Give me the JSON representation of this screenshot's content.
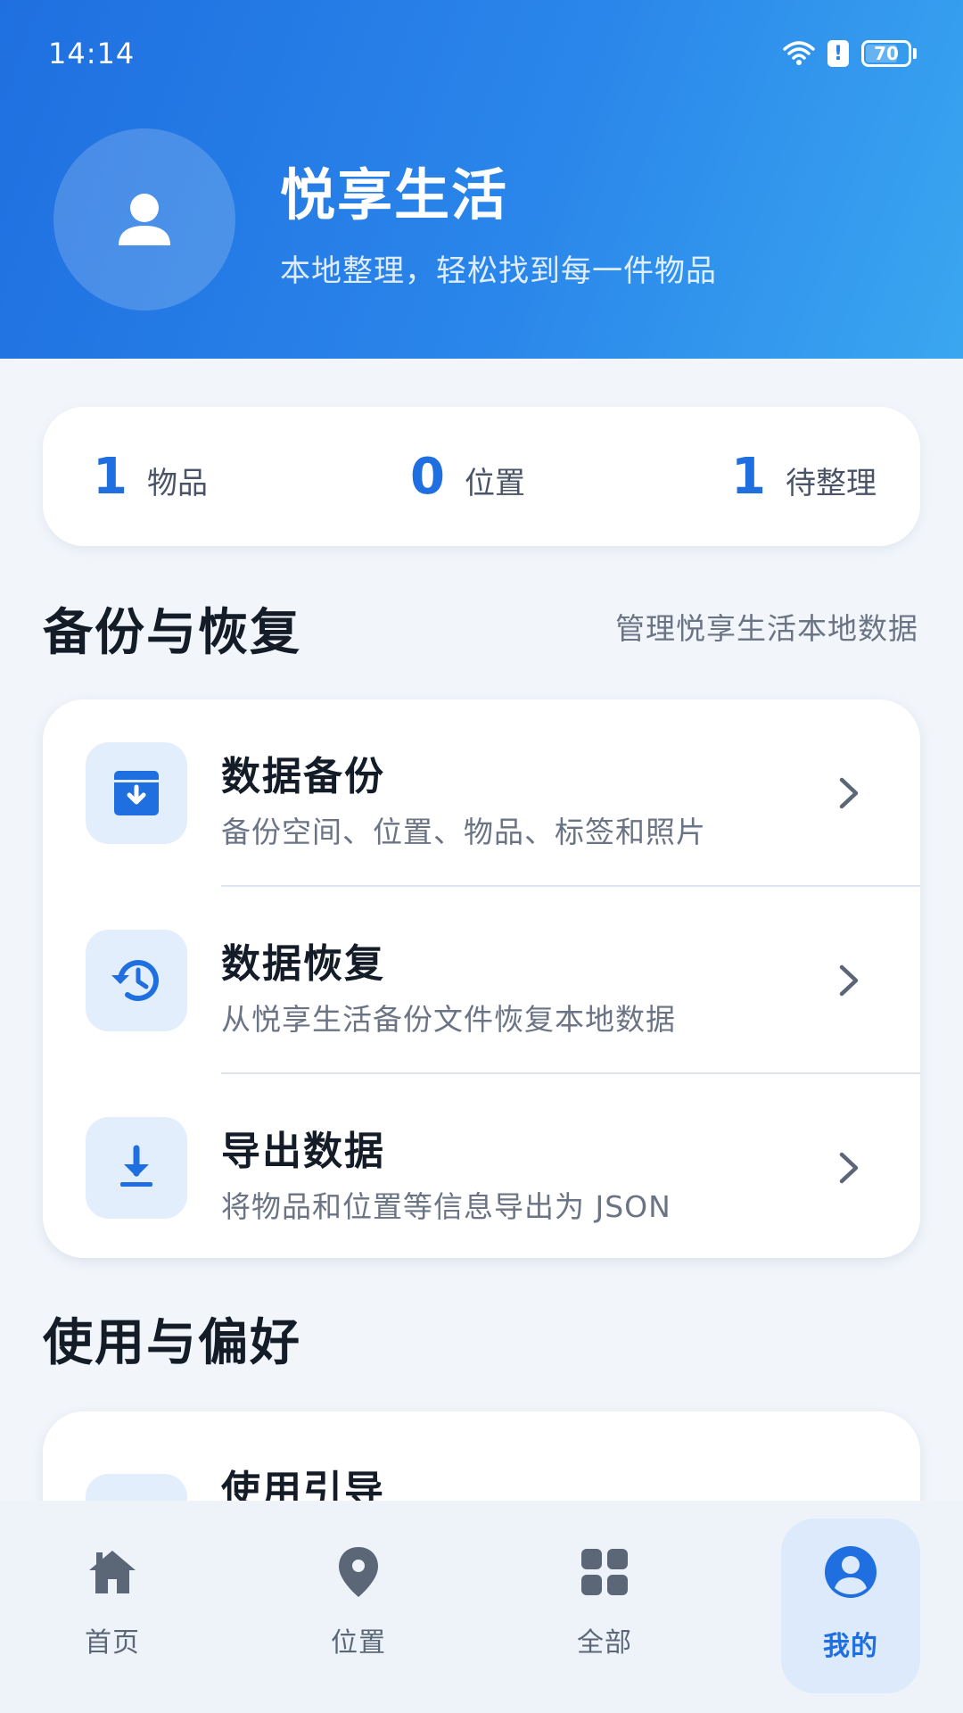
{
  "status_bar": {
    "time": "14:14",
    "battery_level": "70",
    "icons": [
      "wifi-icon",
      "alert-icon",
      "battery-icon"
    ]
  },
  "profile": {
    "title": "悦享生活",
    "subtitle": "本地整理，轻松找到每一件物品",
    "avatar_icon": "person-icon"
  },
  "stats": [
    {
      "value": "1",
      "label": "物品"
    },
    {
      "value": "0",
      "label": "位置"
    },
    {
      "value": "1",
      "label": "待整理"
    }
  ],
  "backup_section": {
    "title": "备份与恢复",
    "note": "管理悦享生活本地数据",
    "items": [
      {
        "title": "数据备份",
        "desc": "备份空间、位置、物品、标签和照片",
        "icon": "archive-download-icon"
      },
      {
        "title": "数据恢复",
        "desc": "从悦享生活备份文件恢复本地数据",
        "icon": "history-restore-icon"
      },
      {
        "title": "导出数据",
        "desc": "将物品和位置等信息导出为 JSON",
        "icon": "download-icon"
      }
    ]
  },
  "preferences_section": {
    "title": "使用与偏好",
    "items": [
      {
        "title": "使用引导",
        "icon": "guide-icon"
      }
    ]
  },
  "bottom_nav": {
    "items": [
      {
        "label": "首页",
        "icon": "home-icon"
      },
      {
        "label": "位置",
        "icon": "location-pin-icon"
      },
      {
        "label": "全部",
        "icon": "grid-icon"
      },
      {
        "label": "我的",
        "icon": "profile-icon",
        "active": true
      }
    ]
  },
  "colors": {
    "accent": "#1f6fe0",
    "header_start": "#1f6fe0",
    "header_end": "#3aa6f0",
    "background": "#f2f6fb",
    "icon_tile": "#e3eefc"
  }
}
